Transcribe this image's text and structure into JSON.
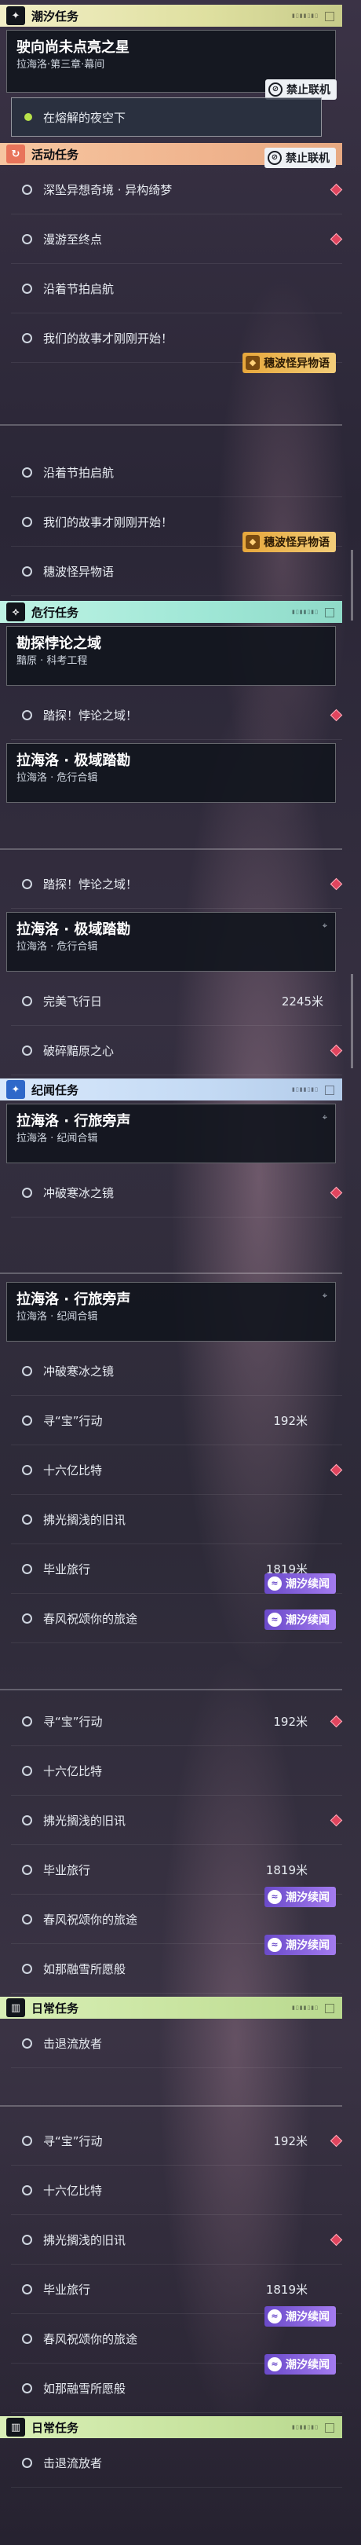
{
  "colors": {
    "accent_red": "#e0455e",
    "tide_purple": "#8a63e0",
    "story_gold": "#e7a73b",
    "progress_green": "#b8e24a"
  },
  "sections": {
    "tide": {
      "title": "潮汐任务",
      "icon": "sparkle-icon"
    },
    "activity": {
      "title": "活动任务",
      "icon": "activity-icon"
    },
    "danger": {
      "title": "危行任务",
      "icon": "danger-icon"
    },
    "chronicle": {
      "title": "纪闻任务",
      "icon": "chronicle-icon"
    },
    "daily": {
      "title": "日常任务",
      "icon": "book-icon"
    }
  },
  "quests": {
    "tide_main": {
      "title": "驶向尚未点亮之星",
      "subtitle": "拉海洛·第三章·幕间"
    },
    "tide_step": "在熔解的夜空下",
    "danger_main": {
      "title": "勘探悖论之域",
      "subtitle": "黯原 · 科考工程"
    },
    "danger_step": "踏探！悖论之域！",
    "danger_main2": {
      "title": "拉海洛 · 极域踏勘",
      "subtitle": "拉海洛 · 危行合辑"
    },
    "chronicle_main": {
      "title": "拉海洛 · 行旅旁声",
      "subtitle": "拉海洛 · 纪闻合辑"
    },
    "daily_item": "击退流放者"
  },
  "activity_items": [
    "深坠异想奇境 · 异构绮梦",
    "漫游至终点",
    "沿着节拍启航",
    "我们的故事才刚刚开始！",
    "穗波怪异物语"
  ],
  "danger_items2": [
    {
      "label": "完美飞行日",
      "dist": "2245米"
    },
    {
      "label": "破碎黯原之心",
      "dist": ""
    }
  ],
  "chronicle_items": [
    {
      "label": "冲破寒冰之镜",
      "dist": ""
    },
    {
      "label": "寻“宝”行动",
      "dist": "192米"
    },
    {
      "label": "十六亿比特",
      "dist": ""
    },
    {
      "label": "拂光搁浅的旧讯",
      "dist": ""
    },
    {
      "label": "毕业旅行",
      "dist": "1819米"
    },
    {
      "label": "春风祝颂你的旅途",
      "dist": ""
    },
    {
      "label": "如那融雪所愿般",
      "dist": ""
    }
  ],
  "badges": {
    "ban": "禁止联机",
    "tide": "潮汐续闻",
    "story": "穗波怪异物语"
  }
}
